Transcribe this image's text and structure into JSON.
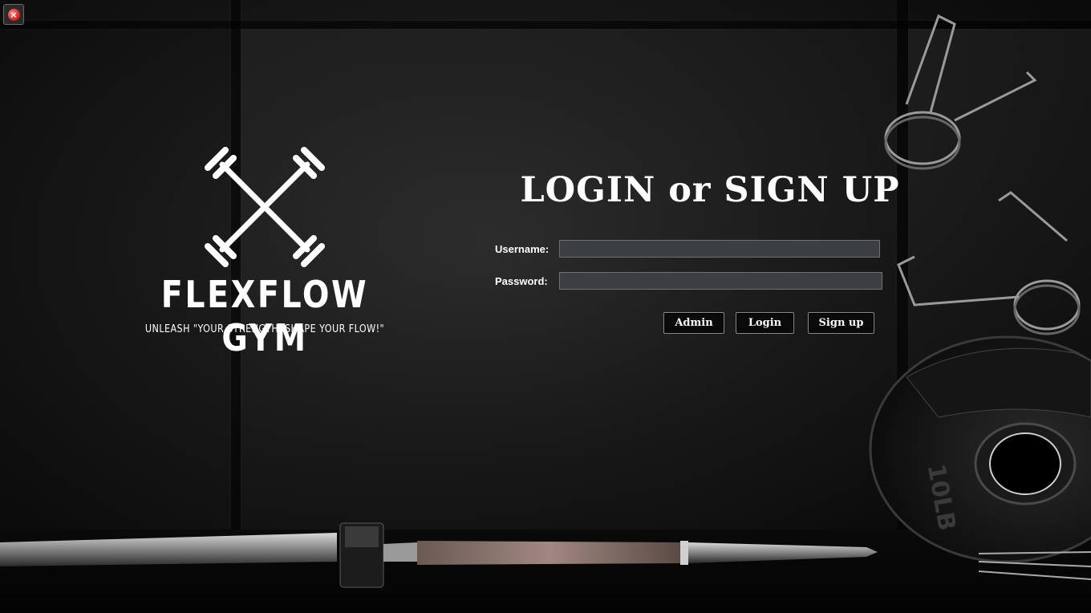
{
  "window": {
    "close_icon_glyph": "×"
  },
  "brand": {
    "name": "FLEXFLOW GYM",
    "tagline": "UNLEASH \"YOUR STRENGTH. SHAPE YOUR FLOW!\"",
    "logo_icon": "crossed-dumbbells-icon"
  },
  "login": {
    "title": "LOGIN or SIGN UP",
    "username_label": "Username:",
    "username_value": "",
    "password_label": "Password:",
    "password_value": "",
    "admin_button": "Admin",
    "login_button": "Login",
    "signup_button": "Sign up"
  },
  "colors": {
    "background": "#111111",
    "text": "#ffffff",
    "input_bg": "#3c3f41",
    "close_red": "#d92a2a"
  }
}
